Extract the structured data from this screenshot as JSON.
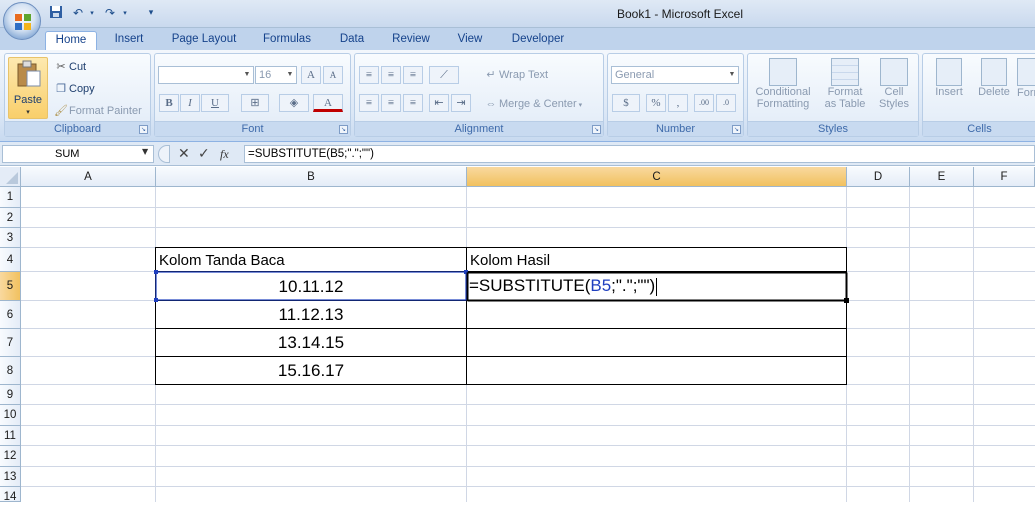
{
  "window": {
    "title": "Book1 - Microsoft Excel"
  },
  "quick_access": {
    "items": [
      "save-icon",
      "undo-icon",
      "redo-icon",
      "customize-icon"
    ]
  },
  "tabs": [
    {
      "label": "Home",
      "active": true
    },
    {
      "label": "Insert"
    },
    {
      "label": "Page Layout"
    },
    {
      "label": "Formulas"
    },
    {
      "label": "Data"
    },
    {
      "label": "Review"
    },
    {
      "label": "View"
    },
    {
      "label": "Developer"
    }
  ],
  "ribbon": {
    "clipboard": {
      "label": "Clipboard",
      "paste": "Paste",
      "cut": "Cut",
      "copy": "Copy",
      "format_painter": "Format Painter"
    },
    "font": {
      "label": "Font",
      "font_size": "16",
      "bold": "B",
      "italic": "I",
      "underline": "U",
      "grow": "A",
      "shrink": "A",
      "font_color": "A"
    },
    "alignment": {
      "label": "Alignment",
      "wrap_text": "Wrap Text",
      "merge_center": "Merge & Center"
    },
    "number": {
      "label": "Number",
      "format": "General",
      "percent": "%",
      "comma": ",",
      "inc_decimal": ".00",
      "dec_decimal": ".0"
    },
    "styles": {
      "label": "Styles",
      "conditional": "Conditional",
      "conditional2": "Formatting",
      "format_table": "Format",
      "format_table2": "as Table",
      "cell_styles": "Cell",
      "cell_styles2": "Styles"
    },
    "cells": {
      "label": "Cells",
      "insert": "Insert",
      "delete": "Delete",
      "format": "Form"
    }
  },
  "formula_bar": {
    "name_box": "SUM",
    "fx": "fx",
    "formula": "=SUBSTITUTE(B5;\".\";\"\")"
  },
  "sheet": {
    "columns": [
      "A",
      "B",
      "C",
      "D",
      "E",
      "F"
    ],
    "rows": [
      "1",
      "2",
      "3",
      "4",
      "5",
      "6",
      "7",
      "8",
      "9",
      "10",
      "11",
      "12",
      "13",
      "14"
    ],
    "header_b": "Kolom Tanda Baca",
    "header_c": "Kolom Hasil",
    "b_values": [
      "10.11.12",
      "11.12.13",
      "13.14.15",
      "15.16.17"
    ],
    "edit_prefix": "=SUBSTITUTE(",
    "edit_ref": "B5",
    "edit_suffix": ";\".\";\"\")"
  },
  "colors": {
    "accent": "#15428b",
    "selected_header": "#f1c15f",
    "reference": "#1f3fbf"
  }
}
